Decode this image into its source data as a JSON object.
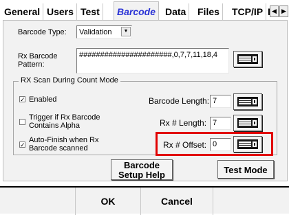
{
  "tabs": [
    {
      "label": "General"
    },
    {
      "label": "Users"
    },
    {
      "label": "Test"
    },
    {
      "label": "Barcode"
    },
    {
      "label": "Data"
    },
    {
      "label": "Files"
    },
    {
      "label": "TCP/IP"
    },
    {
      "label": "I"
    }
  ],
  "tab_nav": {
    "prev": "◀",
    "next": "▶"
  },
  "barcode_type": {
    "label": "Barcode Type:",
    "value": "Validation"
  },
  "rx_pattern": {
    "label": "Rx Barcode Pattern:",
    "value": "######################,0,7,7,11,18,4"
  },
  "rx_scan": {
    "title": "RX Scan During Count Mode",
    "enabled": {
      "label": "Enabled",
      "checked": true
    },
    "trigger_alpha": {
      "label": "Trigger if Rx Barcode Contains Alpha",
      "checked": false
    },
    "auto_finish": {
      "label": "Auto-Finish when Rx Barcode scanned",
      "checked": true
    },
    "barcode_length": {
      "label": "Barcode Length:",
      "value": "7"
    },
    "rx_length": {
      "label": "Rx # Length:",
      "value": "7"
    },
    "rx_offset": {
      "label": "Rx # Offset:",
      "value": "0"
    }
  },
  "buttons": {
    "setup_help": "Barcode Setup Help",
    "test_mode": "Test Mode",
    "ok": "OK",
    "cancel": "Cancel"
  },
  "colors": {
    "active_tab": "#2a33d6",
    "highlight": "#e10000"
  },
  "icons": {
    "keyboard": "keyboard-icon",
    "dropdown": "chevron-down-icon",
    "check": "checkmark-icon"
  }
}
